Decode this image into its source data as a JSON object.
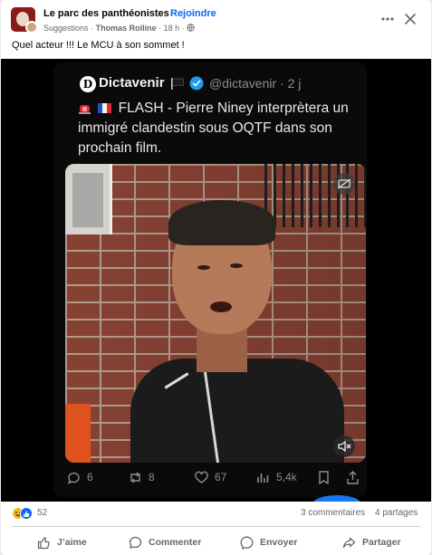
{
  "header": {
    "group_name": "Le parc des panthéonistes",
    "join_label": "Rejoindre",
    "suggestions_label": "Suggestions",
    "separator": "·",
    "author": "Thomas Rolline",
    "time": "18 h",
    "more_icon": "more-horizontal-icon",
    "close_icon": "close-icon"
  },
  "post": {
    "text": "Quel acteur !!! Le MCU à son sommet !"
  },
  "tweet": {
    "logo_letter": "D",
    "name": "Dictavenir",
    "handle_time": "@dictavenir · 2 j",
    "body": "FLASH - Pierre Niney interprètera un immigré clandestin sous OQTF dans son prochain film.",
    "stats": {
      "replies": "6",
      "retweets": "8",
      "likes": "67",
      "views": "5,4k"
    }
  },
  "reactions": {
    "count": "52",
    "comments": "3 commentaires",
    "shares": "4 partages"
  },
  "actions": {
    "like": "J’aime",
    "comment": "Commenter",
    "send": "Envoyer",
    "share": "Partager"
  },
  "colors": {
    "accent": "#0866ff",
    "secondary_text": "#65676b",
    "tweet_bg": "#0a0a0a",
    "verified": "#1d9bf0"
  }
}
